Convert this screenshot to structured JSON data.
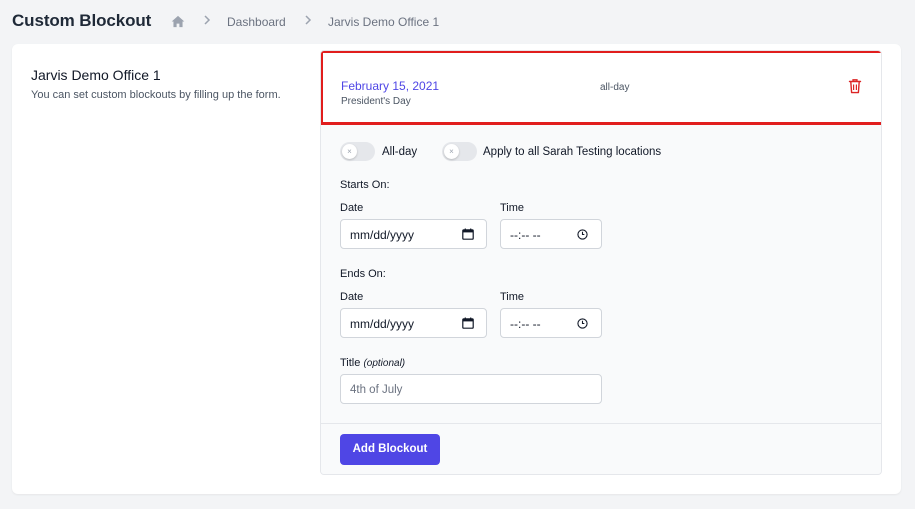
{
  "header": {
    "title": "Custom Blockout",
    "breadcrumb": [
      "Dashboard",
      "Jarvis Demo Office 1"
    ]
  },
  "sidebar": {
    "title": "Jarvis Demo Office 1",
    "description": "You can set custom blockouts by filling up the form."
  },
  "blockouts": [
    {
      "date": "February 15, 2021",
      "name": "President's Day",
      "duration": "all-day"
    }
  ],
  "form": {
    "allday_toggle": {
      "label": "All-day",
      "on": false
    },
    "apply_all_toggle": {
      "label": "Apply to all Sarah Testing locations",
      "on": false
    },
    "toggle_off_glyph": "×",
    "starts": {
      "heading": "Starts On:",
      "date_label": "Date",
      "date_value": "mm/dd/yyyy",
      "time_label": "Time",
      "time_value": "--:-- --"
    },
    "ends": {
      "heading": "Ends On:",
      "date_label": "Date",
      "date_value": "mm/dd/yyyy",
      "time_label": "Time",
      "time_value": "--:-- --"
    },
    "title_label": "Title",
    "title_optional": "(optional)",
    "title_placeholder": "4th of July",
    "submit_label": "Add Blockout"
  },
  "colors": {
    "accent": "#4f46e5",
    "danger": "#dc2626",
    "highlight": "#e11d1d"
  }
}
